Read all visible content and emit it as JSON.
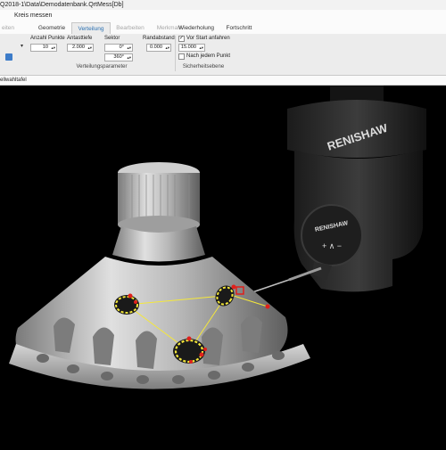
{
  "window": {
    "title": "Q2018-1\\Data\\Demodatenbank.QrtMess[Db]"
  },
  "menu": {
    "item": "Kreis messen"
  },
  "tabs": [
    {
      "label": "eiten",
      "state": "disabled"
    },
    {
      "label": "Geometrie",
      "state": "normal"
    },
    {
      "label": "Verteilung",
      "state": "active"
    },
    {
      "label": "Bearbeiten",
      "state": "disabled"
    },
    {
      "label": "Merkmale",
      "state": "disabled"
    },
    {
      "label": "Wiederholung",
      "state": "normal"
    },
    {
      "label": "Fortschritt",
      "state": "normal"
    }
  ],
  "ribbon": {
    "anzahl_label": "Anzahl Punkte",
    "anzahl_value": "10",
    "antast_label": "Antasttiefe",
    "antast_value": "2.000",
    "sektor_label": "Sektor",
    "sektor_start": "0°",
    "sektor_end": "360°",
    "rand_label": "Randabstand",
    "rand_value": "0.000",
    "verteilung_group": "Verteilungsparameter",
    "vorstart_label": "Vor Start anfahren",
    "vorstart_checked": true,
    "vorstart_value": "15.000",
    "nachjedem_label": "Nach jedem Punkt",
    "nachjedem_checked": false,
    "sicherheit_group": "Sicherheitsebene"
  },
  "status": {
    "text": "ellwahltafel"
  },
  "scene": {
    "probe_brand": "RENISHAW",
    "accent_point": "#e0201b",
    "accent_touch": "#f5e83a",
    "part_color": "#bdbdbd"
  }
}
